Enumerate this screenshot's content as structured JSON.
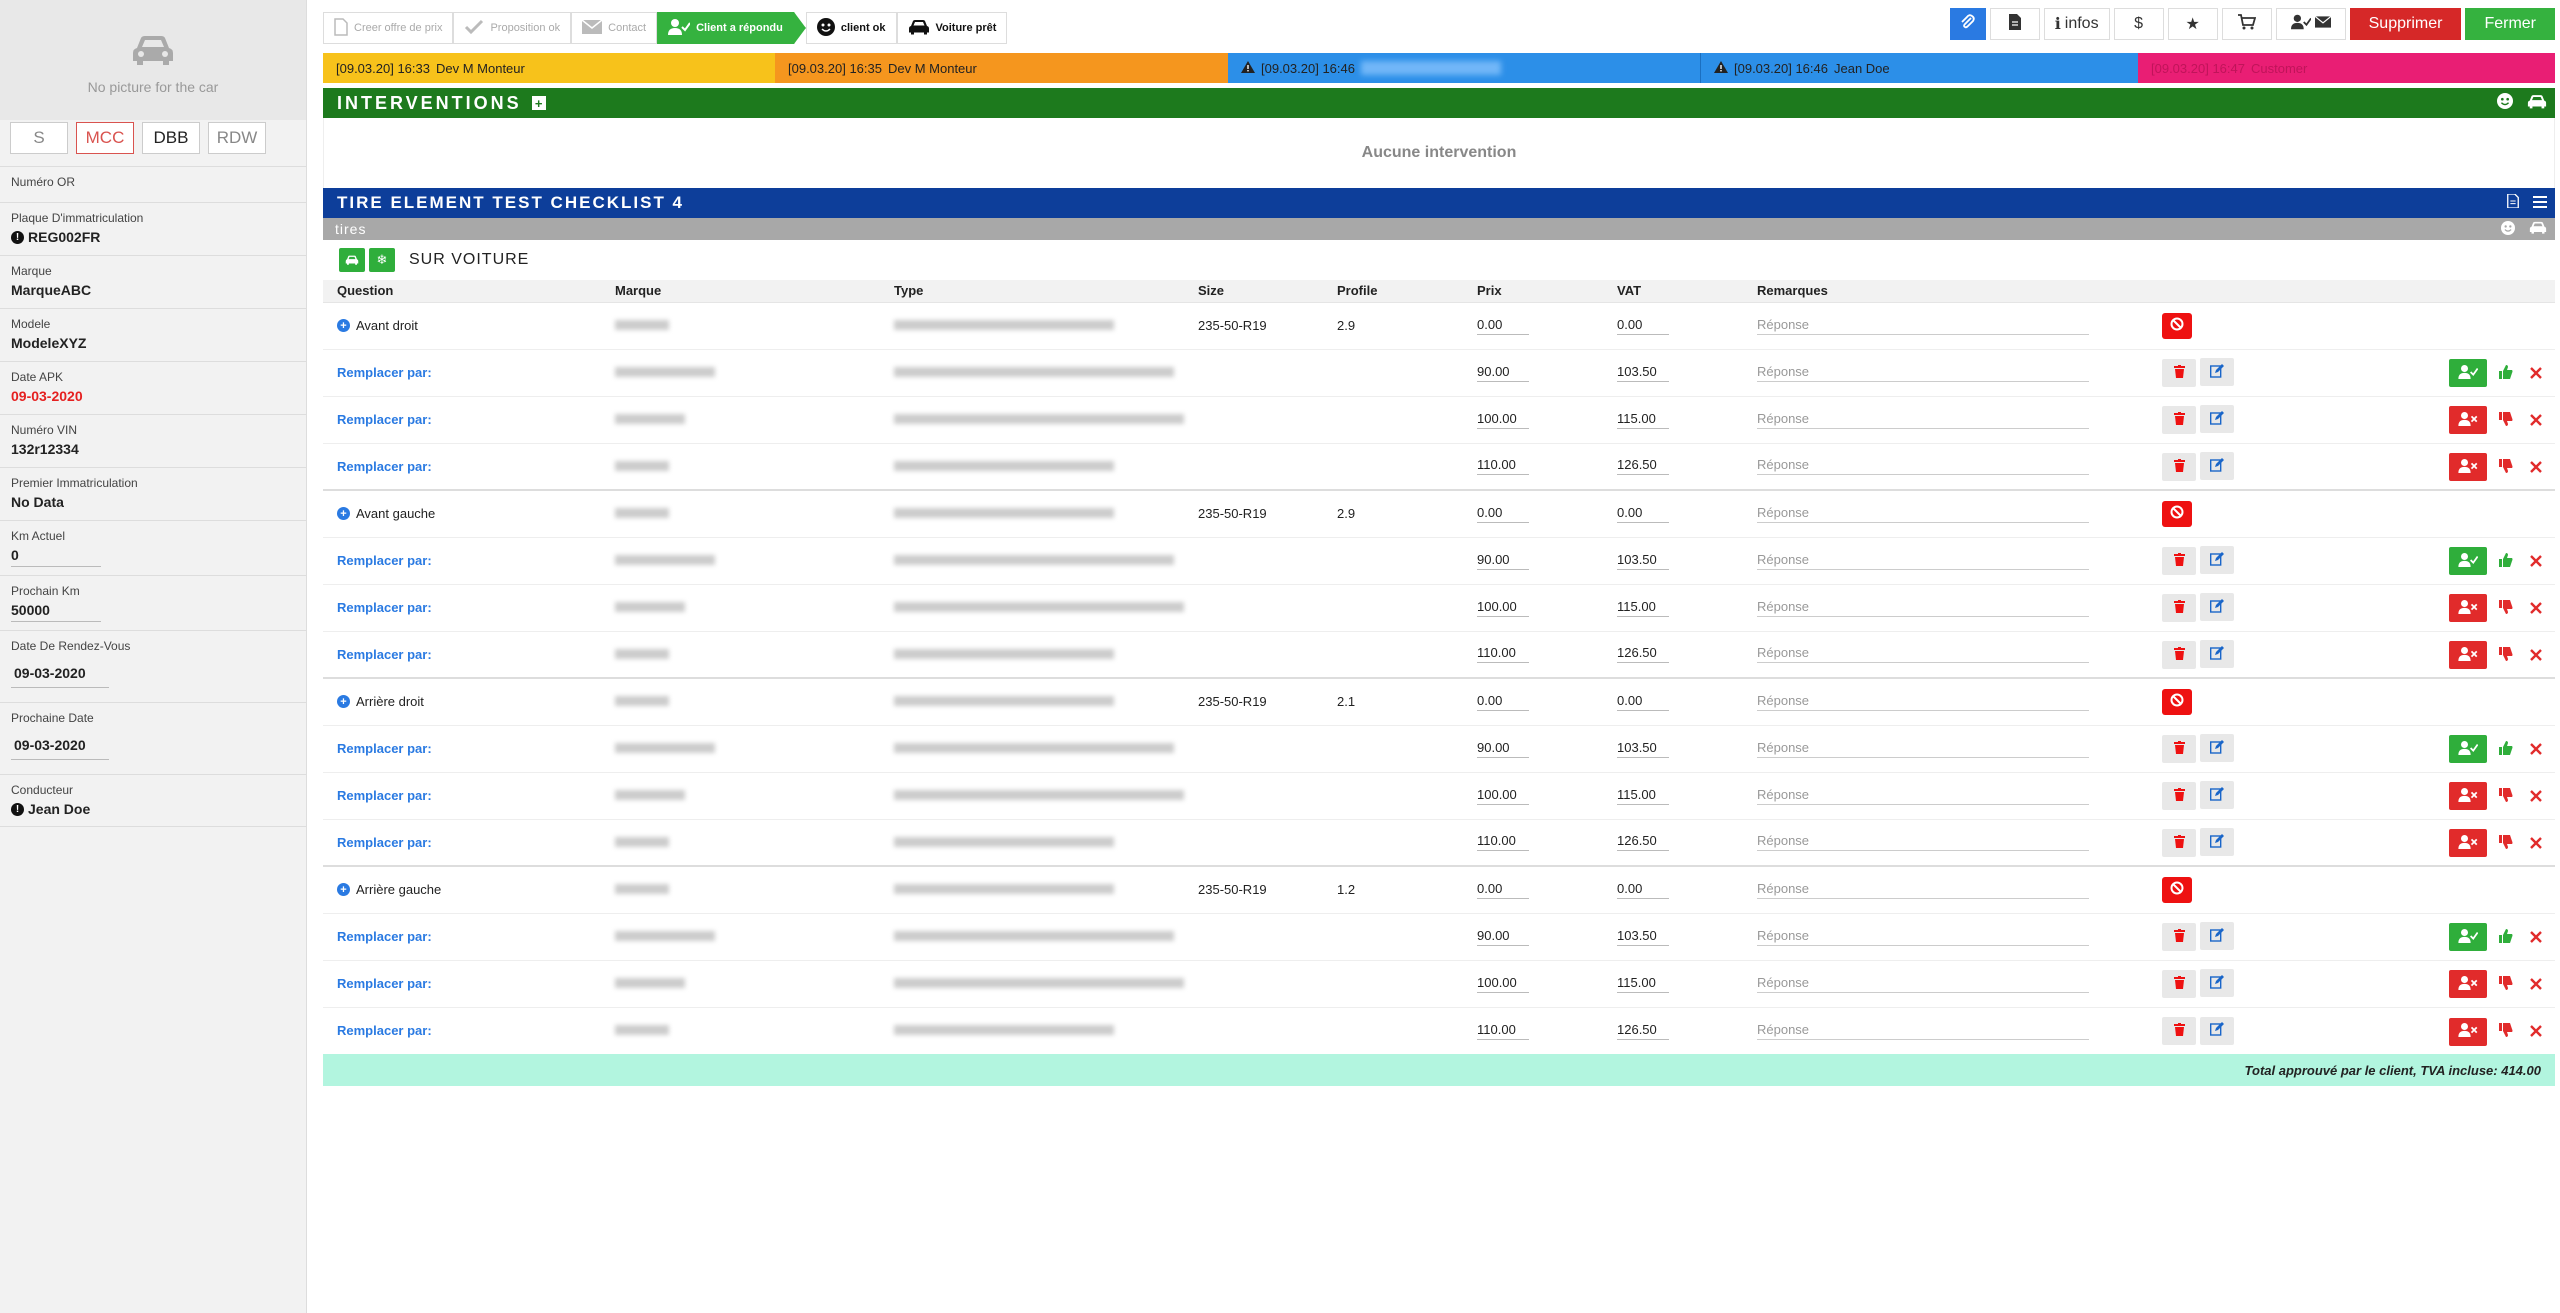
{
  "sidebar": {
    "no_picture": "No picture for the car",
    "tabs": [
      "S",
      "MCC",
      "DBB",
      "RDW"
    ],
    "fields": [
      {
        "label": "Numéro OR",
        "value": ""
      },
      {
        "label": "Plaque D'immatriculation",
        "value": "REG002FR"
      },
      {
        "label": "Marque",
        "value": "MarqueABC"
      },
      {
        "label": "Modele",
        "value": "ModeleXYZ"
      },
      {
        "label": "Date APK",
        "value": "09-03-2020"
      },
      {
        "label": "Numéro VIN",
        "value": "132r12334"
      },
      {
        "label": "Premier Immatriculation",
        "value": "No Data"
      },
      {
        "label": "Km Actuel",
        "value": "0"
      },
      {
        "label": "Prochain Km",
        "value": "50000"
      },
      {
        "label": "Date De Rendez-Vous",
        "value": "09-03-2020"
      },
      {
        "label": "Prochaine Date",
        "value": "09-03-2020"
      },
      {
        "label": "Conducteur",
        "value": "Jean Doe"
      }
    ]
  },
  "steps": [
    "Creer offre de prix",
    "Proposition ok",
    "Contact",
    "Client a répondu",
    "client ok",
    "Voiture prêt"
  ],
  "toolbar": {
    "infos": "infos",
    "delete": "Supprimer",
    "close": "Fermer"
  },
  "timeline": [
    {
      "time": "[09.03.20] 16:33",
      "name": "Dev M Monteur",
      "color": "#f7c21b"
    },
    {
      "time": "[09.03.20] 16:35",
      "name": "Dev M Monteur",
      "color": "#f5961e"
    },
    {
      "time": "[09.03.20] 16:46",
      "name": "",
      "color": "#2c8fe8"
    },
    {
      "time": "[09.03.20] 16:46",
      "name": "Jean Doe",
      "color": "#2c8fe8"
    },
    {
      "time": "[09.03.20] 16:47",
      "name": "Customer",
      "color": "#e91e74"
    }
  ],
  "interventions": {
    "title": "INTERVENTIONS",
    "empty": "Aucune intervention"
  },
  "checklist": {
    "title": "TIRE ELEMENT TEST CHECKLIST 4",
    "group": "tires",
    "section": "SUR VOITURE",
    "columns": [
      "Question",
      "Marque",
      "Type",
      "Size",
      "Profile",
      "Prix",
      "VAT",
      "Remarques"
    ],
    "placeholder": "Réponse",
    "replace_label": "Remplacer par:",
    "positions": [
      {
        "name": "Avant droit",
        "size": "235-50-R19",
        "profile": "2.9"
      },
      {
        "name": "Avant gauche",
        "size": "235-50-R19",
        "profile": "2.9"
      },
      {
        "name": "Arrière droit",
        "size": "235-50-R19",
        "profile": "2.1"
      },
      {
        "name": "Arrière gauche",
        "size": "235-50-R19",
        "profile": "1.2"
      }
    ],
    "main_prix": "0.00",
    "main_vat": "0.00",
    "options": [
      {
        "prix": "90.00",
        "vat": "103.50",
        "status": "approved"
      },
      {
        "prix": "100.00",
        "vat": "115.00",
        "status": "rejected"
      },
      {
        "prix": "110.00",
        "vat": "126.50",
        "status": "rejected"
      }
    ],
    "total": "Total approuvé par le client, TVA incluse: 414.00"
  },
  "colors": {
    "green": "#2fae3b",
    "red": "#e12b2b",
    "blue": "#2a7ae2",
    "navy": "#0d3e9a",
    "darkgreen": "#1d7a1d"
  }
}
